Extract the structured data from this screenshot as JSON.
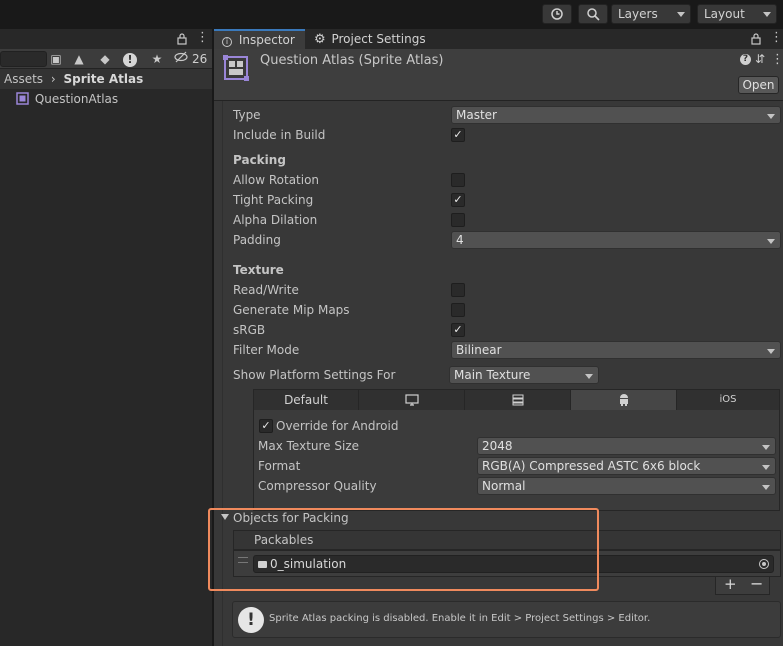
{
  "toolbar": {
    "history_icon": "history-icon",
    "search_icon": "search-icon",
    "layers_label": "Layers",
    "layout_label": "Layout"
  },
  "left_panel": {
    "hidden_count": "26",
    "breadcrumb_root": "Assets",
    "breadcrumb_current": "Sprite Atlas",
    "items": [
      {
        "label": "QuestionAtlas"
      }
    ]
  },
  "inspector": {
    "tabs": [
      {
        "label": "Inspector"
      },
      {
        "label": "Project Settings"
      }
    ],
    "title": "Question Atlas (Sprite Atlas)",
    "open_label": "Open",
    "fields": {
      "type": {
        "label": "Type",
        "value": "Master"
      },
      "include_in_build": {
        "label": "Include in Build",
        "checked": true
      }
    },
    "packing": {
      "title": "Packing",
      "allow_rotation": {
        "label": "Allow Rotation",
        "checked": false
      },
      "tight_packing": {
        "label": "Tight Packing",
        "checked": true
      },
      "alpha_dilation": {
        "label": "Alpha Dilation",
        "checked": false
      },
      "padding": {
        "label": "Padding",
        "value": "4"
      }
    },
    "texture": {
      "title": "Texture",
      "read_write": {
        "label": "Read/Write",
        "checked": false
      },
      "generate_mip_maps": {
        "label": "Generate Mip Maps",
        "checked": false
      },
      "srgb": {
        "label": "sRGB",
        "checked": true
      },
      "filter_mode": {
        "label": "Filter Mode",
        "value": "Bilinear"
      }
    },
    "platform": {
      "label": "Show Platform Settings For",
      "value": "Main Texture",
      "tabs": [
        {
          "label": "Default"
        },
        {
          "icon": "monitor-icon"
        },
        {
          "icon": "server-icon"
        },
        {
          "icon": "android-icon"
        },
        {
          "label": "iOS"
        }
      ],
      "override_label": "Override for Android",
      "max_texture_size": {
        "label": "Max Texture Size",
        "value": "2048"
      },
      "format": {
        "label": "Format",
        "value": "RGB(A) Compressed ASTC 6x6 block"
      },
      "compressor_quality": {
        "label": "Compressor Quality",
        "value": "Normal"
      }
    },
    "objects": {
      "title": "Objects for Packing",
      "packables_label": "Packables",
      "items": [
        {
          "value": "0_simulation"
        }
      ]
    },
    "info": "Sprite Atlas packing is disabled. Enable it in Edit > Project Settings > Editor."
  },
  "colors": {
    "accent": "#3a79bb",
    "highlight": "#f08a5d",
    "panel": "#383838"
  }
}
